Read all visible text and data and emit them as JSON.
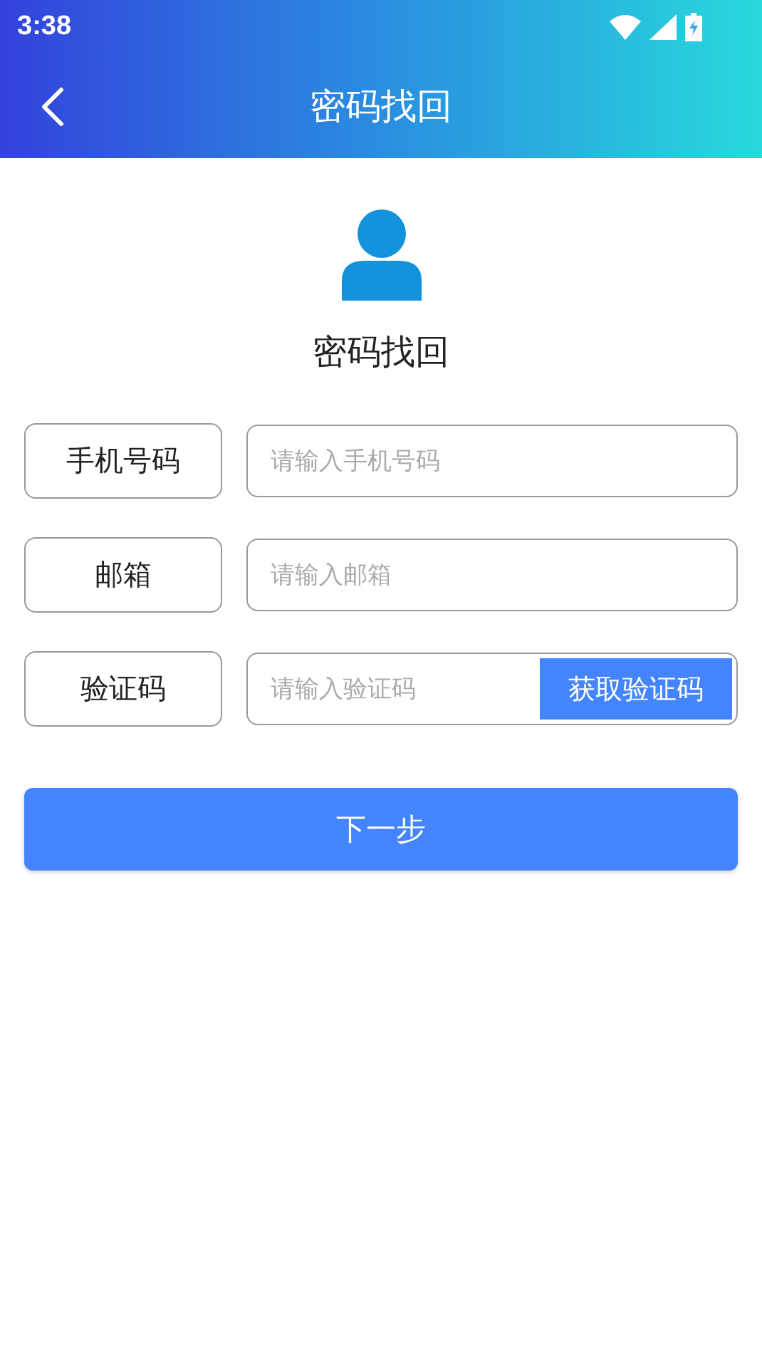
{
  "status_bar": {
    "time": "3:38"
  },
  "header": {
    "title": "密码找回"
  },
  "heading": "密码找回",
  "fields": [
    {
      "kind": "text",
      "label": "手机号码",
      "placeholder": "请输入手机号码"
    },
    {
      "kind": "text",
      "label": "邮箱",
      "placeholder": "请输入邮箱"
    },
    {
      "kind": "code",
      "label": "验证码",
      "placeholder": "请输入验证码",
      "button": "获取验证码"
    }
  ],
  "submit": "下一步"
}
